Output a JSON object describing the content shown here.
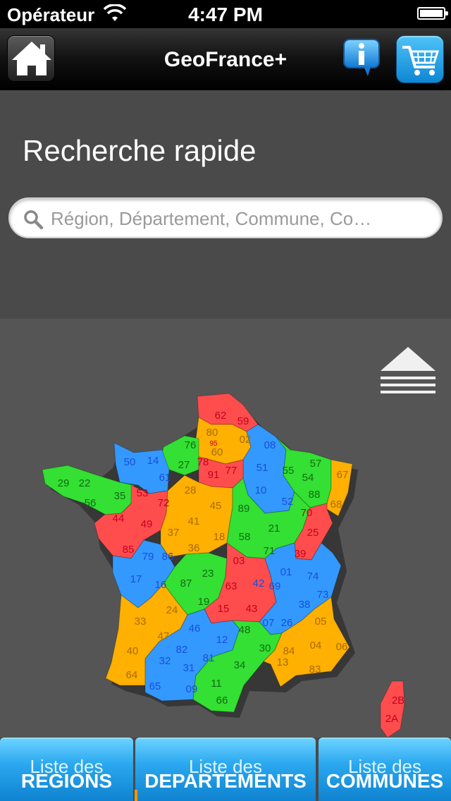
{
  "status_bar": {
    "carrier": "Opérateur",
    "time": "4:47 PM"
  },
  "nav": {
    "title": "GeoFrance+"
  },
  "search": {
    "title": "Recherche rapide",
    "placeholder": "Région, Département, Commune, Co…"
  },
  "colors": {
    "red": "#ff4d4d",
    "orange": "#ffb000",
    "green": "#33e033",
    "blue": "#3399ff",
    "label_blue": "#1a4fd6",
    "label_red": "#c4001f",
    "label_orange": "#a86a00",
    "label_green": "#136b13"
  },
  "map": {
    "departments": [
      {
        "code": "62",
        "region": "red"
      },
      {
        "code": "59",
        "region": "red"
      },
      {
        "code": "80",
        "region": "orange"
      },
      {
        "code": "02",
        "region": "orange"
      },
      {
        "code": "60",
        "region": "orange"
      },
      {
        "code": "08",
        "region": "blue"
      },
      {
        "code": "51",
        "region": "blue"
      },
      {
        "code": "10",
        "region": "blue"
      },
      {
        "code": "52",
        "region": "blue"
      },
      {
        "code": "55",
        "region": "green"
      },
      {
        "code": "57",
        "region": "green"
      },
      {
        "code": "54",
        "region": "green"
      },
      {
        "code": "88",
        "region": "green"
      },
      {
        "code": "67",
        "region": "orange"
      },
      {
        "code": "68",
        "region": "orange"
      },
      {
        "code": "76",
        "region": "green"
      },
      {
        "code": "27",
        "region": "green"
      },
      {
        "code": "95",
        "region": "red"
      },
      {
        "code": "78",
        "region": "red"
      },
      {
        "code": "91",
        "region": "red"
      },
      {
        "code": "77",
        "region": "red"
      },
      {
        "code": "50",
        "region": "blue"
      },
      {
        "code": "14",
        "region": "blue"
      },
      {
        "code": "61",
        "region": "blue"
      },
      {
        "code": "29",
        "region": "green"
      },
      {
        "code": "22",
        "region": "green"
      },
      {
        "code": "56",
        "region": "green"
      },
      {
        "code": "35",
        "region": "green"
      },
      {
        "code": "53",
        "region": "red"
      },
      {
        "code": "72",
        "region": "red"
      },
      {
        "code": "44",
        "region": "red"
      },
      {
        "code": "49",
        "region": "red"
      },
      {
        "code": "85",
        "region": "red"
      },
      {
        "code": "28",
        "region": "orange"
      },
      {
        "code": "45",
        "region": "orange"
      },
      {
        "code": "41",
        "region": "orange"
      },
      {
        "code": "37",
        "region": "orange"
      },
      {
        "code": "36",
        "region": "orange"
      },
      {
        "code": "18",
        "region": "orange"
      },
      {
        "code": "89",
        "region": "green"
      },
      {
        "code": "21",
        "region": "green"
      },
      {
        "code": "58",
        "region": "green"
      },
      {
        "code": "71",
        "region": "green"
      },
      {
        "code": "70",
        "region": "red"
      },
      {
        "code": "25",
        "region": "red"
      },
      {
        "code": "39",
        "region": "red"
      },
      {
        "code": "79",
        "region": "blue"
      },
      {
        "code": "86",
        "region": "blue"
      },
      {
        "code": "17",
        "region": "blue"
      },
      {
        "code": "16",
        "region": "blue"
      },
      {
        "code": "87",
        "region": "green"
      },
      {
        "code": "23",
        "region": "green"
      },
      {
        "code": "19",
        "region": "green"
      },
      {
        "code": "03",
        "region": "red"
      },
      {
        "code": "63",
        "region": "red"
      },
      {
        "code": "15",
        "region": "red"
      },
      {
        "code": "43",
        "region": "red"
      },
      {
        "code": "01",
        "region": "blue"
      },
      {
        "code": "74",
        "region": "blue"
      },
      {
        "code": "42",
        "region": "blue"
      },
      {
        "code": "69",
        "region": "blue"
      },
      {
        "code": "73",
        "region": "blue"
      },
      {
        "code": "38",
        "region": "blue"
      },
      {
        "code": "07",
        "region": "blue"
      },
      {
        "code": "26",
        "region": "blue"
      },
      {
        "code": "33",
        "region": "orange"
      },
      {
        "code": "24",
        "region": "orange"
      },
      {
        "code": "47",
        "region": "orange"
      },
      {
        "code": "40",
        "region": "orange"
      },
      {
        "code": "64",
        "region": "orange"
      },
      {
        "code": "46",
        "region": "blue"
      },
      {
        "code": "12",
        "region": "blue"
      },
      {
        "code": "82",
        "region": "blue"
      },
      {
        "code": "81",
        "region": "blue"
      },
      {
        "code": "32",
        "region": "blue"
      },
      {
        "code": "31",
        "region": "blue"
      },
      {
        "code": "65",
        "region": "blue"
      },
      {
        "code": "09",
        "region": "blue"
      },
      {
        "code": "48",
        "region": "green"
      },
      {
        "code": "30",
        "region": "green"
      },
      {
        "code": "34",
        "region": "green"
      },
      {
        "code": "11",
        "region": "green"
      },
      {
        "code": "66",
        "region": "green"
      },
      {
        "code": "05",
        "region": "orange"
      },
      {
        "code": "04",
        "region": "orange"
      },
      {
        "code": "06",
        "region": "orange"
      },
      {
        "code": "84",
        "region": "orange"
      },
      {
        "code": "13",
        "region": "orange"
      },
      {
        "code": "83",
        "region": "orange"
      },
      {
        "code": "2B",
        "region": "red"
      },
      {
        "code": "2A",
        "region": "red"
      }
    ]
  },
  "tabs": [
    {
      "small": "Liste des",
      "big": "REGIONS"
    },
    {
      "small": "Liste des",
      "big": "DEPARTEMENTS"
    },
    {
      "small": "Liste des",
      "big": "COMMUNES"
    }
  ],
  "icons": {
    "home": "home-icon",
    "info": "info-icon",
    "cart": "cart-icon",
    "search": "search-icon",
    "collapse": "collapse-arrow-icon"
  }
}
